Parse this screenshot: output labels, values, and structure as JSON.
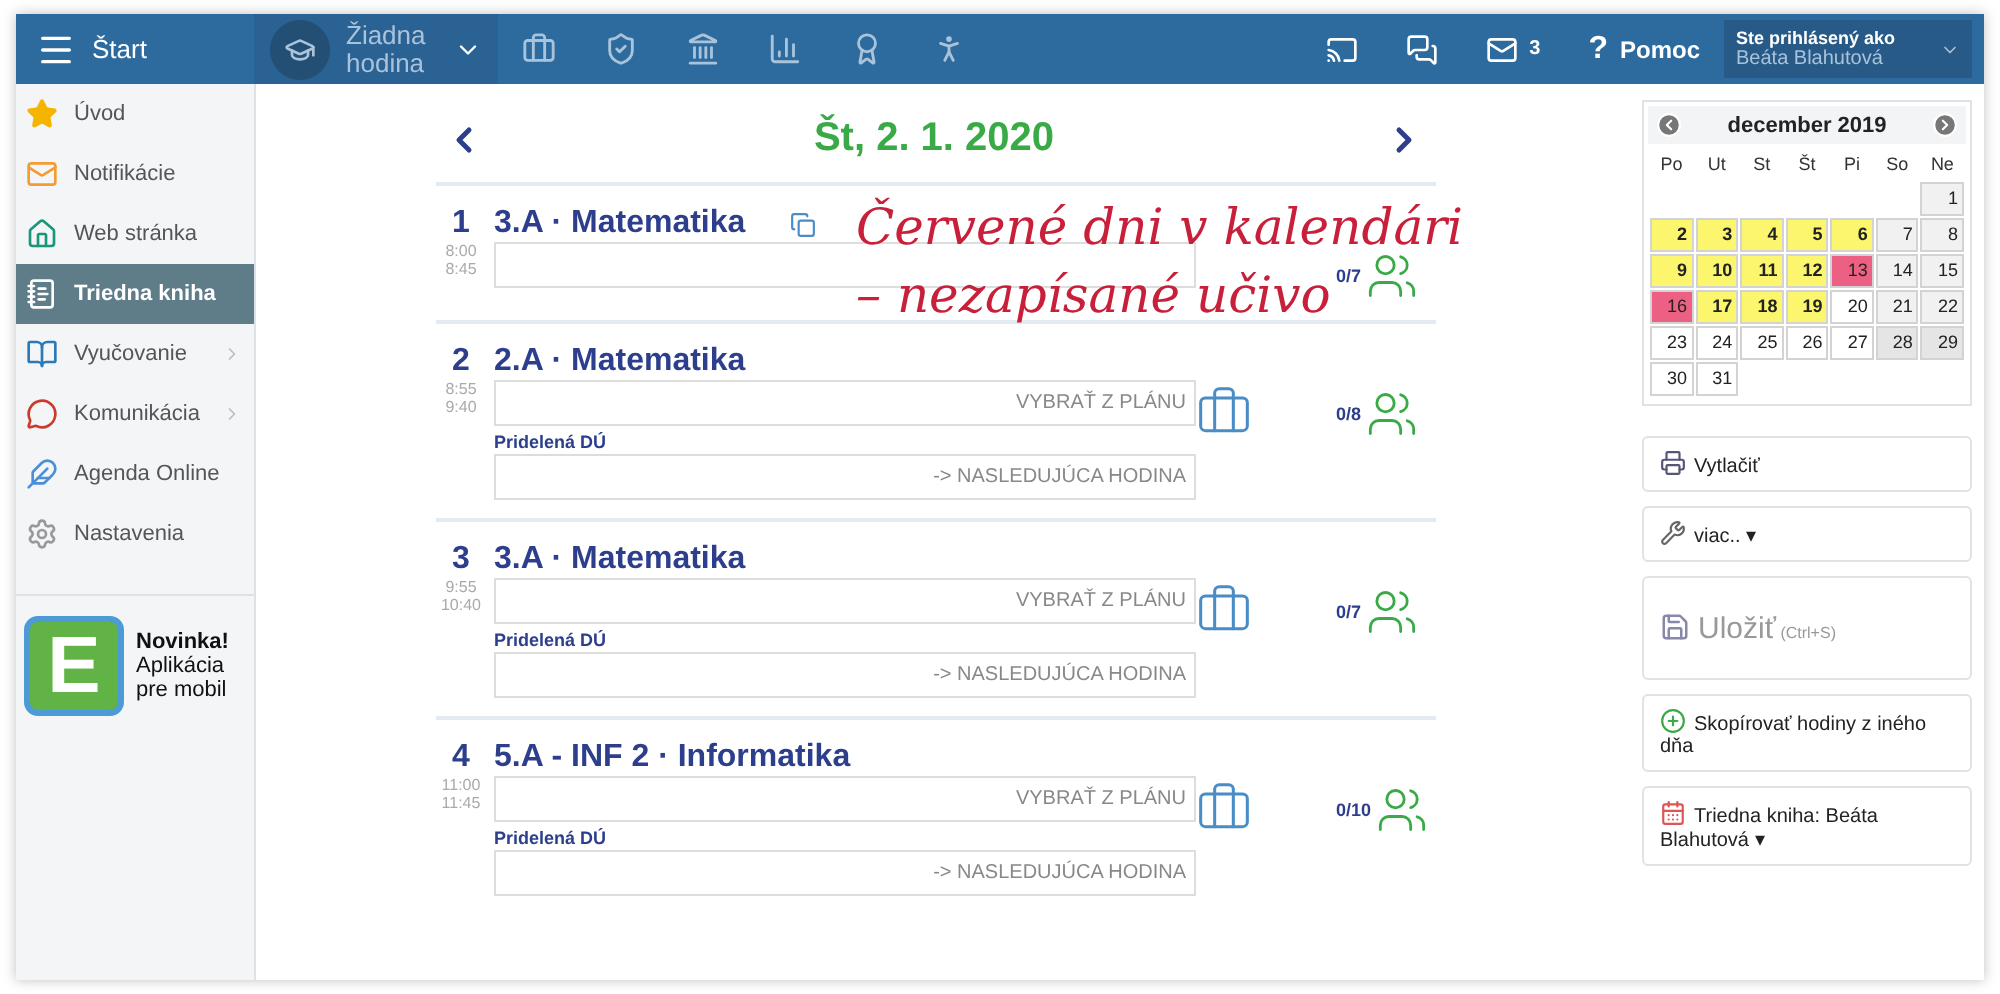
{
  "top_bar": {
    "start_label": "Štart",
    "lesson_select": "Žiadna hodina",
    "mail_count": "3",
    "help_mark": "?",
    "help_label": "Pomoc",
    "user": {
      "caption": "Ste prihlásený ako",
      "name": "Beáta Blahutová"
    }
  },
  "sidebar": {
    "items": [
      {
        "label": "Úvod",
        "selected": false,
        "submenu": false
      },
      {
        "label": "Notifikácie",
        "selected": false,
        "submenu": false
      },
      {
        "label": "Web stránka",
        "selected": false,
        "submenu": false
      },
      {
        "label": "Triedna kniha",
        "selected": true,
        "submenu": false
      },
      {
        "label": "Vyučovanie",
        "selected": false,
        "submenu": true
      },
      {
        "label": "Komunikácia",
        "selected": false,
        "submenu": true
      },
      {
        "label": "Agenda Online",
        "selected": false,
        "submenu": false
      },
      {
        "label": "Nastavenia",
        "selected": false,
        "submenu": false
      }
    ],
    "promo": {
      "logo_letter": "E",
      "title": "Novinka!",
      "text": "Aplikácia pre mobil"
    }
  },
  "day": {
    "title": "Št, 2. 1. 2020",
    "lessons": [
      {
        "number": "1",
        "title": "3.A · Matematika",
        "copy_icon": true,
        "start": "8:00",
        "end": "8:45",
        "count": "0/7"
      },
      {
        "number": "2",
        "title": "2.A · Matematika",
        "copy_icon": false,
        "start": "8:55",
        "end": "9:40",
        "plan_placeholder": "VYBRAŤ Z PLÁNU",
        "homework_label": "Pridelená DÚ",
        "homework_placeholder": "-> NASLEDUJÚCA HODINA",
        "count": "0/8"
      },
      {
        "number": "3",
        "title": "3.A · Matematika",
        "copy_icon": false,
        "start": "9:55",
        "end": "10:40",
        "plan_placeholder": "VYBRAŤ Z PLÁNU",
        "homework_label": "Pridelená DÚ",
        "homework_placeholder": "-> NASLEDUJÚCA HODINA",
        "count": "0/7"
      },
      {
        "number": "4",
        "title": "5.A - INF 2 · Informatika",
        "copy_icon": false,
        "start": "11:00",
        "end": "11:45",
        "plan_placeholder": "VYBRAŤ Z PLÁNU",
        "homework_label": "Pridelená DÚ",
        "homework_placeholder": "-> NASLEDUJÚCA HODINA",
        "count": "0/10"
      }
    ]
  },
  "annotation": {
    "lines": [
      "Červené dni v kalendári",
      "– nezapísané učivo"
    ]
  },
  "calendar": {
    "month": "december 2019",
    "weekdays": [
      "Po",
      "Ut",
      "St",
      "Št",
      "Pi",
      "So",
      "Ne"
    ],
    "weeks": [
      [
        {
          "day": "1",
          "kind": "weekend"
        }
      ],
      [
        {
          "day": "2",
          "kind": "planned"
        },
        {
          "day": "3",
          "kind": "planned"
        },
        {
          "day": "4",
          "kind": "planned"
        },
        {
          "day": "5",
          "kind": "planned"
        },
        {
          "day": "6",
          "kind": "planned"
        },
        {
          "day": "7",
          "kind": "weekend"
        },
        {
          "day": "8",
          "kind": "weekend"
        }
      ],
      [
        {
          "day": "9",
          "kind": "planned"
        },
        {
          "day": "10",
          "kind": "planned"
        },
        {
          "day": "11",
          "kind": "planned"
        },
        {
          "day": "12",
          "kind": "planned"
        },
        {
          "day": "13",
          "kind": "missing"
        },
        {
          "day": "14",
          "kind": "weekend"
        },
        {
          "day": "15",
          "kind": "weekend"
        }
      ],
      [
        {
          "day": "16",
          "kind": "missing"
        },
        {
          "day": "17",
          "kind": "planned"
        },
        {
          "day": "18",
          "kind": "planned"
        },
        {
          "day": "19",
          "kind": "planned"
        },
        {
          "day": "20",
          "kind": "open"
        },
        {
          "day": "21",
          "kind": "weekend"
        },
        {
          "day": "22",
          "kind": "weekend"
        }
      ],
      [
        {
          "day": "23",
          "kind": "open"
        },
        {
          "day": "24",
          "kind": "open"
        },
        {
          "day": "25",
          "kind": "open"
        },
        {
          "day": "26",
          "kind": "open"
        },
        {
          "day": "27",
          "kind": "open"
        },
        {
          "day": "28",
          "kind": "holiday"
        },
        {
          "day": "29",
          "kind": "holiday"
        }
      ],
      [
        {
          "day": "30",
          "kind": "open"
        },
        {
          "day": "31",
          "kind": "open"
        }
      ]
    ]
  },
  "actions": [
    {
      "kind": "print",
      "label": "Vytlačiť",
      "disabled": false
    },
    {
      "kind": "more",
      "label": "viac.. ▾",
      "disabled": false
    },
    {
      "kind": "save",
      "label": "Uložiť",
      "shortcut": "(Ctrl+S)",
      "disabled": true
    },
    {
      "kind": "copy",
      "label": "Skopírovať hodiny z iného dňa",
      "disabled": false
    },
    {
      "kind": "book",
      "label": "Triedna kniha: Beáta Blahutová ▾",
      "disabled": false
    }
  ]
}
